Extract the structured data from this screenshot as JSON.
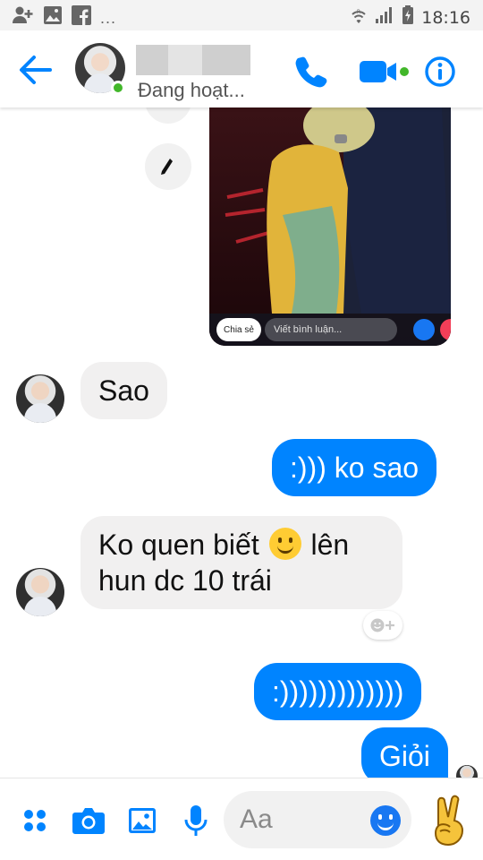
{
  "status_bar": {
    "time": "18:16",
    "overflow_indicator": "...",
    "icons": [
      "add-contact-icon",
      "image-icon",
      "facebook-icon",
      "wifi-icon",
      "signal-icon",
      "battery-icon"
    ]
  },
  "header": {
    "presence": "Đang hoạt...",
    "icons": [
      "back-arrow-icon",
      "phone-icon",
      "video-camera-icon",
      "info-icon"
    ],
    "accent_color": "#0084ff",
    "online_color": "#42b72a"
  },
  "shared_post": {
    "share_label": "Chia sẻ",
    "comment_placeholder": "Viết bình luận..."
  },
  "messages": [
    {
      "from": "them",
      "text": "Sao"
    },
    {
      "from": "me",
      "text": ":))) ko sao"
    },
    {
      "from": "them",
      "line1_before": "Ko quen biết",
      "line1_after": "lên",
      "line2": "hun dc 10 trái",
      "emoji": "slightly-smiling-face"
    },
    {
      "from": "me",
      "text": ":)))))))))))))"
    },
    {
      "from": "me",
      "text": "Giỏi"
    }
  ],
  "composer": {
    "placeholder": "Aa",
    "icons": [
      "more-dots-icon",
      "camera-icon",
      "gallery-icon",
      "microphone-icon",
      "smile-emoji-icon",
      "victory-hand-icon"
    ]
  },
  "colors": {
    "outgoing_bubble": "#0084ff",
    "incoming_bubble": "#f1f0f0"
  }
}
